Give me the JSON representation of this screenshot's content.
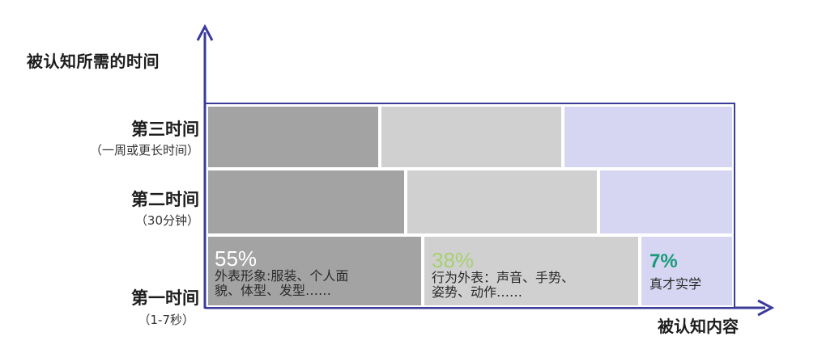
{
  "axes": {
    "y_label": "被认知所需的时间",
    "x_label": "被认知内容"
  },
  "rows": [
    {
      "title": "第三时间",
      "sub": "（一周或更长时间）"
    },
    {
      "title": "第二时间",
      "sub": "（30分钟）"
    },
    {
      "title": "第一时间",
      "sub": "（1-7秒）"
    }
  ],
  "cells": {
    "appearance": {
      "percent": "55%",
      "line1": "外表形象:服装、个人面",
      "line2": "貌、体型、发型……"
    },
    "behavior": {
      "percent": "38%",
      "line1": "行为外表：声音、手势、",
      "line2": "姿势、动作……"
    },
    "talent": {
      "percent": "7%",
      "line1": "真才实学"
    }
  },
  "colors": {
    "axis": "#3b3b9a",
    "dark_cell": "#a3a3a3",
    "mid_cell": "#d0d0d0",
    "lavender_cell": "#d6d6f2",
    "percent_white": "#ffffff",
    "percent_green": "#a8d070",
    "percent_teal": "#1a9a7a"
  }
}
